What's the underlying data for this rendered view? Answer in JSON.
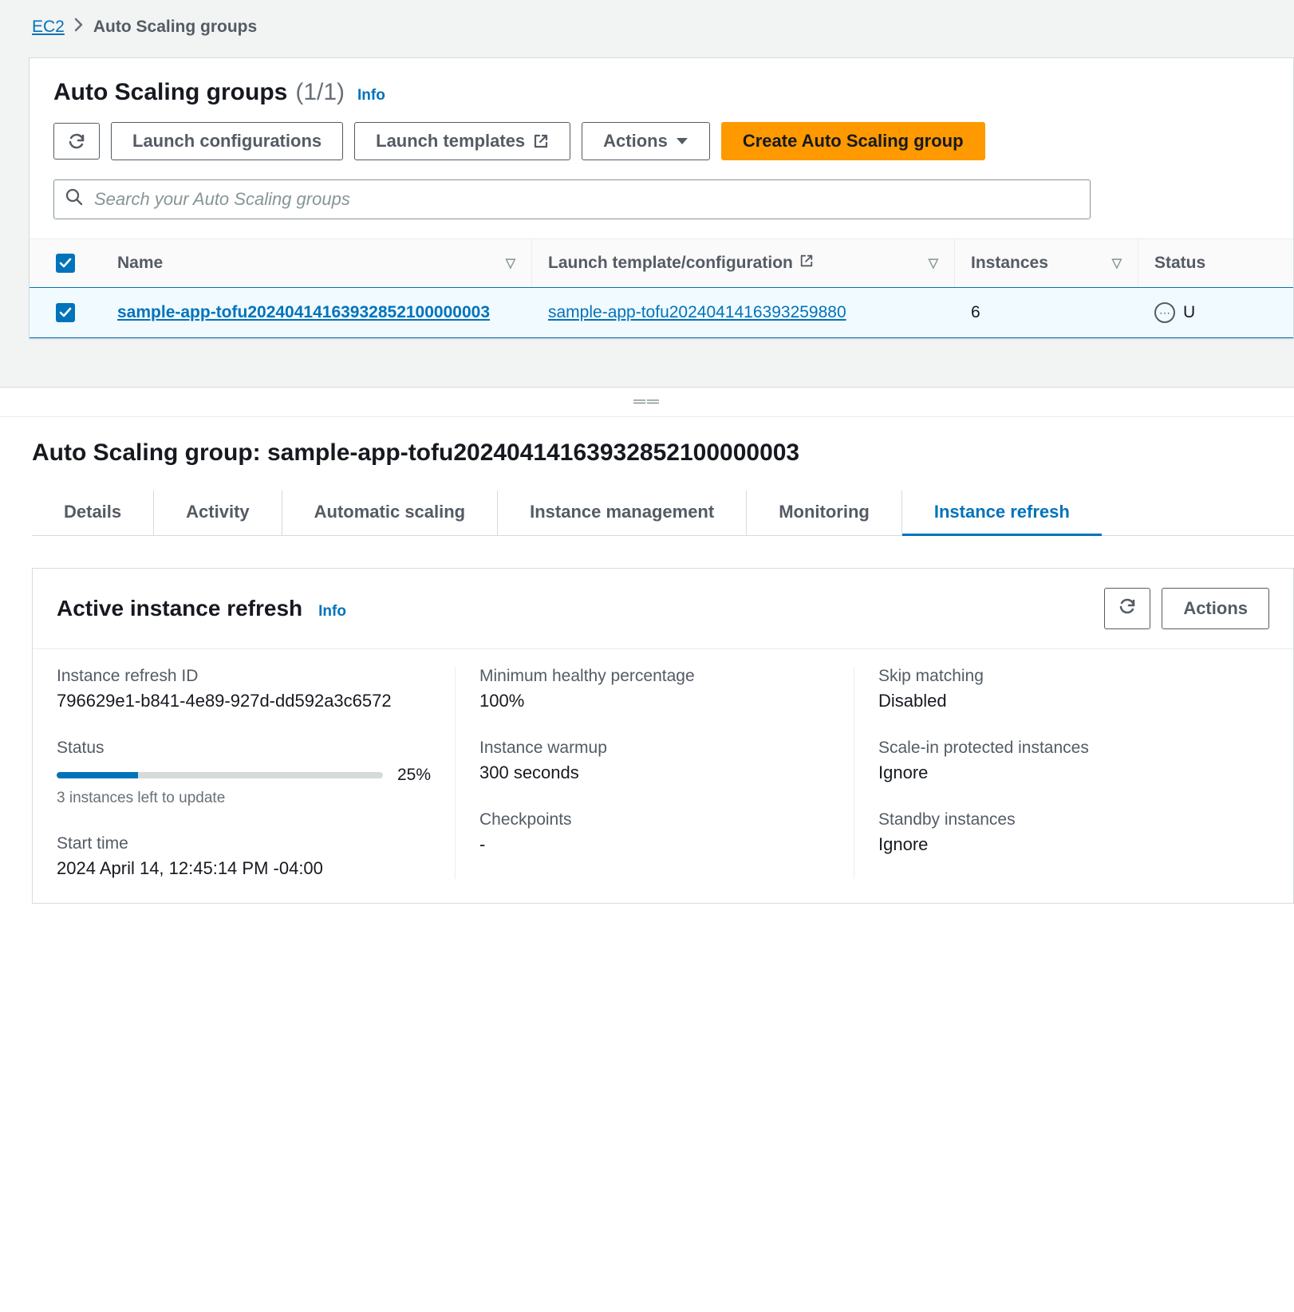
{
  "breadcrumb": {
    "root": "EC2",
    "current": "Auto Scaling groups"
  },
  "list_panel": {
    "title": "Auto Scaling groups",
    "count": "(1/1)",
    "info": "Info",
    "buttons": {
      "launch_configs": "Launch configurations",
      "launch_templates": "Launch templates",
      "actions": "Actions",
      "create": "Create Auto Scaling group"
    },
    "search_placeholder": "Search your Auto Scaling groups",
    "columns": {
      "name": "Name",
      "launch_template": "Launch template/configuration",
      "instances": "Instances",
      "status": "Status"
    },
    "row": {
      "name": "sample-app-tofu20240414163932852100000003",
      "launch_template": "sample-app-tofu2024041416393259880",
      "instances": "6",
      "status": "U"
    }
  },
  "detail": {
    "title_prefix": "Auto Scaling group: ",
    "title_name": "sample-app-tofu20240414163932852100000003",
    "tabs": [
      "Details",
      "Activity",
      "Automatic scaling",
      "Instance management",
      "Monitoring",
      "Instance refresh"
    ],
    "active_tab": "Instance refresh"
  },
  "refresh_card": {
    "title": "Active instance refresh",
    "info": "Info",
    "actions_label": "Actions",
    "fields": {
      "refresh_id_label": "Instance refresh ID",
      "refresh_id_value": "796629e1-b841-4e89-927d-dd592a3c6572",
      "status_label": "Status",
      "progress_pct": "25%",
      "progress_sub": "3 instances left to update",
      "start_label": "Start time",
      "start_value": "2024 April 14, 12:45:14 PM -04:00",
      "min_healthy_label": "Minimum healthy percentage",
      "min_healthy_value": "100%",
      "warmup_label": "Instance warmup",
      "warmup_value": "300 seconds",
      "checkpoints_label": "Checkpoints",
      "checkpoints_value": "-",
      "skip_label": "Skip matching",
      "skip_value": "Disabled",
      "scalein_label": "Scale-in protected instances",
      "scalein_value": "Ignore",
      "standby_label": "Standby instances",
      "standby_value": "Ignore"
    }
  }
}
